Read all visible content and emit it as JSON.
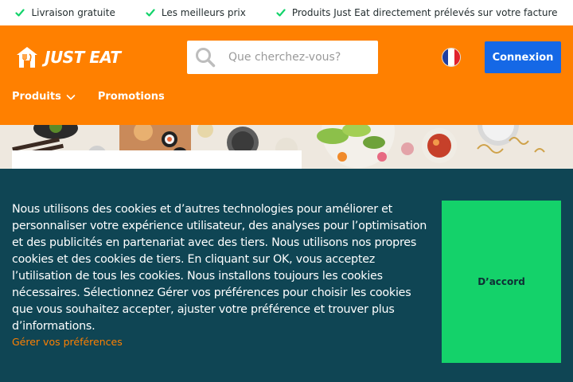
{
  "topbar": {
    "benefits": [
      {
        "label": "Livraison gratuite",
        "icon": "check-icon"
      },
      {
        "label": "Les meilleurs prix",
        "icon": "check-icon"
      },
      {
        "label": "Produits Just Eat directement prélevés sur votre facture",
        "icon": "check-icon"
      }
    ],
    "check_color": "#12d36a"
  },
  "header": {
    "brand": "JUST EAT",
    "background": "#ff8000",
    "search": {
      "placeholder": "Que cherchez-vous?",
      "icon": "search-icon"
    },
    "language_flag": "france-flag-icon",
    "login_label": "Connexion",
    "nav": [
      {
        "label": "Produits",
        "has_dropdown": true
      },
      {
        "label": "Promotions",
        "has_dropdown": false
      }
    ]
  },
  "cookie_banner": {
    "text": "Nous utilisons des cookies et d’autres technologies pour améliorer et personnaliser votre expérience utilisateur, des analyses pour l’optimisation et des publicités en partenariat avec des tiers. Nous utilisons nos propres cookies et des cookies de tiers. En cliquant sur OK, vous acceptez l’utilisation de tous les cookies. Nous installons toujours les cookies nécessaires. Sélectionnez Gérer vos préférences pour choisir les cookies que vous souhaitez accepter, ajuster votre préférence et trouver plus d’informations.",
    "manage_link": "Gérer vos préférences",
    "accept_label": "D’accord",
    "background": "#0f4554",
    "accept_color": "#14d26a",
    "link_color": "#ff8000"
  }
}
